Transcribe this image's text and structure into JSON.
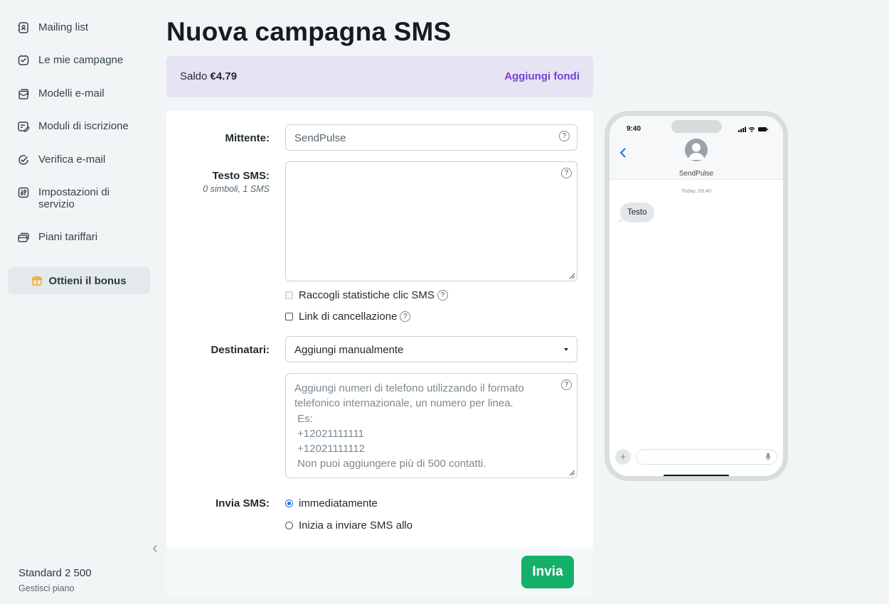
{
  "sidebar": {
    "items": [
      {
        "label": "Mailing list",
        "icon": "contacts-book-icon"
      },
      {
        "label": "Le mie campagne",
        "icon": "campaigns-icon"
      },
      {
        "label": "Modelli e-mail",
        "icon": "templates-icon"
      },
      {
        "label": "Moduli di iscrizione",
        "icon": "form-edit-icon"
      },
      {
        "label": "Verifica e-mail",
        "icon": "check-circle-icon"
      },
      {
        "label": "Impostazioni di servizio",
        "icon": "settings-sliders-icon"
      },
      {
        "label": "Piani tariffari",
        "icon": "pricing-cards-icon"
      }
    ],
    "bonus_label": "Ottieni il bonus",
    "plan_name": "Standard 2 500",
    "plan_link": "Gestisci piano"
  },
  "page": {
    "title": "Nuova campagna SMS"
  },
  "balance": {
    "label": "Saldo",
    "amount": "€4.79",
    "add_funds": "Aggiungi fondi"
  },
  "form": {
    "sender_label": "Mittente:",
    "sender_value": "SendPulse",
    "sms_text_label": "Testo SMS:",
    "sms_text_counter": "0 simboli, 1 SMS",
    "sms_text_value": "",
    "collect_stats_label": "Raccogli statistiche clic SMS",
    "unsubscribe_link_label": "Link di cancellazione",
    "recipients_label": "Destinatari:",
    "recipients_selected": "Aggiungi manualmente",
    "phones_placeholder": "Aggiungi numeri di telefono utilizzando il formato\ntelefonico internazionale, un numero per linea.\n Es:\n +12021111111\n +12021111112\n Non puoi aggiungere più di 500 contatti.",
    "send_sms_label": "Invia SMS:",
    "send_option_now": "immediatamente",
    "send_option_schedule": "Inizia a inviare SMS allo",
    "send_option_selected": "immediatamente",
    "send_button": "Invia"
  },
  "preview": {
    "status_time": "9:40",
    "contact_name": "SendPulse",
    "message_time": "Today, 09:40",
    "message_text": "Testo"
  },
  "colors": {
    "accent_purple": "#7a3fd6",
    "send_green": "#14b06a",
    "balance_bg": "#e6e4f3",
    "radio_blue": "#1a6fe0"
  }
}
